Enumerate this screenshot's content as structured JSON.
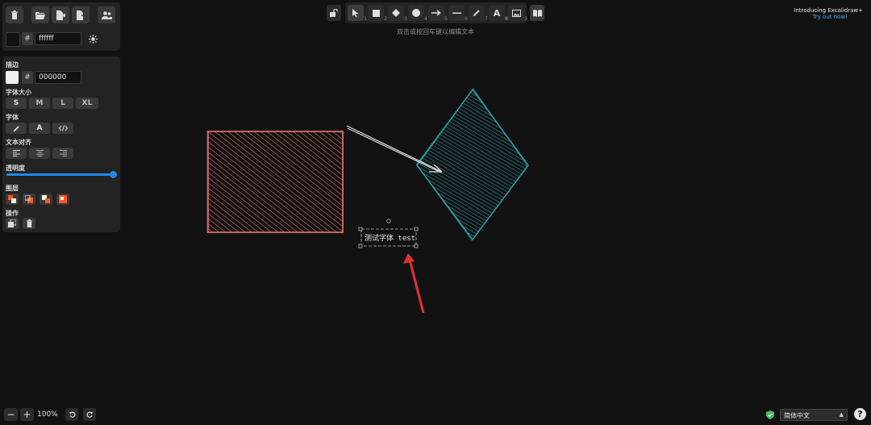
{
  "top_right": {
    "title": "Introducing Excalidraw+",
    "link": "Try out now!"
  },
  "hint": "双击或按回车键以编辑文本",
  "canvas_panel": {
    "bg_hex": "ffffff"
  },
  "props": {
    "stroke_label": "描边",
    "stroke_hex": "000000",
    "font_size_label": "字体大小",
    "font_sizes": [
      "S",
      "M",
      "L",
      "XL"
    ],
    "font_family_label": "字体",
    "text_align_label": "文本对齐",
    "opacity_label": "透明度",
    "opacity": 1.0,
    "layers_label": "图层",
    "actions_label": "操作"
  },
  "toolbar": {
    "keys": [
      "1",
      "2",
      "3",
      "4",
      "5",
      "6",
      "7",
      "8",
      "9"
    ]
  },
  "canvas": {
    "text_element": "测试字体 test",
    "rect_color": "#e57373",
    "diamond_color": "#2f9ea8",
    "arrow_color": "#e03131"
  },
  "footer": {
    "zoom": "100%",
    "language": "简体中文"
  },
  "colors": {
    "accent": "#1e88e5",
    "bg": "#121212",
    "panel": "#232323"
  }
}
